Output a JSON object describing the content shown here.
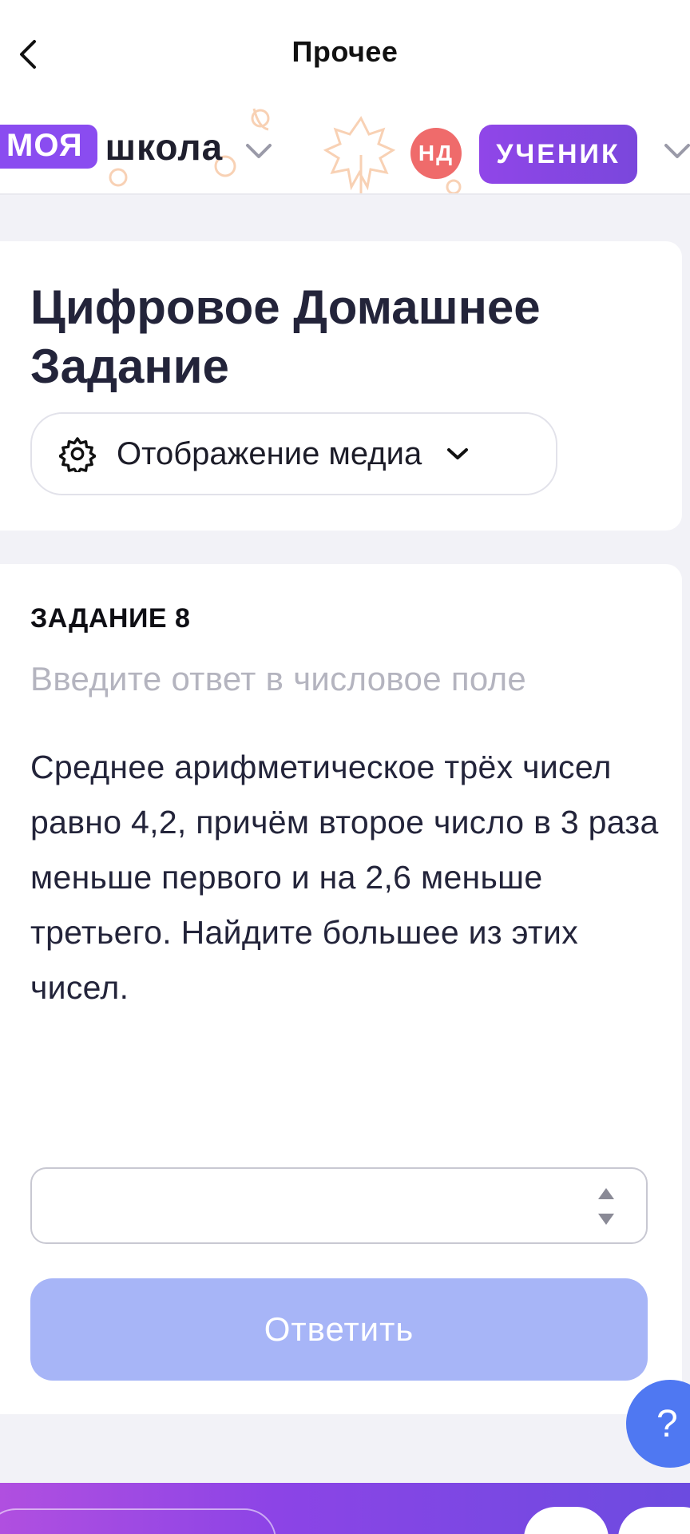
{
  "navbar": {
    "title": "Прочее",
    "back_icon": "chevron-left-icon"
  },
  "header": {
    "logo_moya": "МОЯ",
    "logo_shkola": "школа",
    "avatar_initials": "НД",
    "role": "УЧЕНИК",
    "brand_color": "#8a4cf0",
    "avatar_color": "#ef6b6b"
  },
  "title_card": {
    "title": "Цифровое Домашнее Задание",
    "media_button": {
      "label": "Отображение медиа",
      "icon": "gear-icon"
    }
  },
  "task": {
    "number": "ЗАДАНИЕ 8",
    "hint": "Введите ответ в числовое поле",
    "text": "Среднее арифметическое трёх чисел равно 4,2, причём второе число в 3 раза меньше первого и на 2,6 меньше третьего. Найдите большее из этих чисел.",
    "answer_value": "",
    "submit_label": "Ответить",
    "submit_color": "#a7b5f7"
  },
  "help": {
    "label": "?",
    "color": "#4f78f2"
  }
}
